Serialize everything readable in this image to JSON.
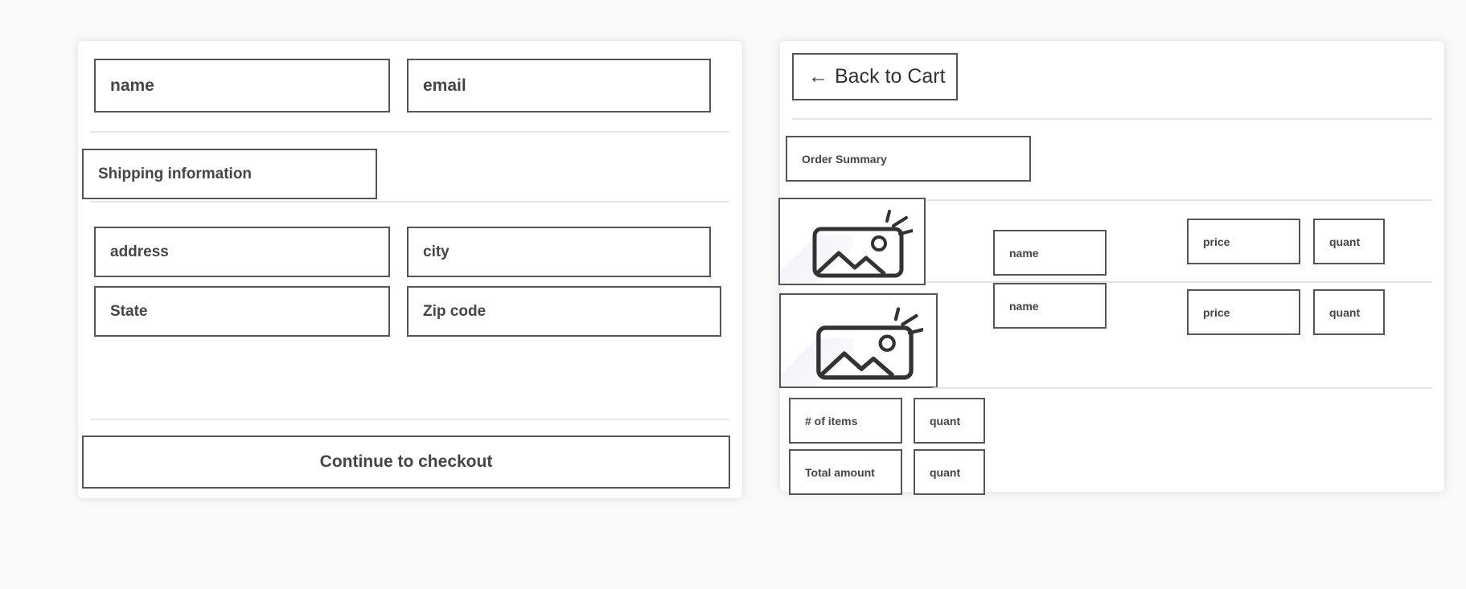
{
  "contact": {
    "name_placeholder": "name",
    "email_placeholder": "email"
  },
  "shipping": {
    "heading": "Shipping information",
    "address_placeholder": "address",
    "city_placeholder": "city",
    "state_placeholder": "State",
    "zip_placeholder": "Zip code"
  },
  "checkout": {
    "continue_label": "Continue to checkout"
  },
  "summary": {
    "back_label": "Back to Cart",
    "back_arrow": "←",
    "title": "Order Summary",
    "title_residue": "/",
    "items": [
      {
        "image": "image-placeholder-icon",
        "name": "name",
        "price": "price",
        "quantity": "quant"
      },
      {
        "image": "image-placeholder-icon",
        "name": "name",
        "price": "price",
        "quantity": "quant"
      }
    ],
    "item_count_label": "# of items",
    "item_count_value": "quant",
    "total_label": "Total amount",
    "total_value": "quant"
  }
}
